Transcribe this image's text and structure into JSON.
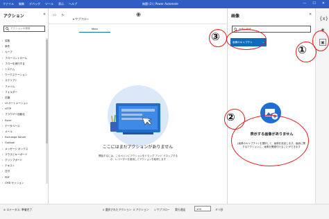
{
  "titlebar": {
    "menu": [
      "ファイル",
      "編集",
      "デバッグ",
      "ツール",
      "表示",
      "ヘルプ"
    ],
    "title": "無題 (2) | Power Automate",
    "win_min": "—",
    "win_max": "☐",
    "win_close": "✕"
  },
  "actions_pane": {
    "title": "アクション",
    "close": "✕",
    "search_placeholder": "アクションの検索",
    "items": [
      "変数",
      "条件",
      "ループ",
      "フローコントロール",
      "フローを実行する",
      "システム",
      "ワークステーション",
      "スクリプト",
      "ファイル",
      "フォルダー",
      "圧縮",
      "UI オートメーション",
      "HTTP",
      "ブラウザー自動化",
      "Excel",
      "データベース",
      "メール",
      "Exchange Server",
      "Outlook",
      "メッセージ ボックス",
      "マウスとキーボード",
      "クリップボード",
      "テキスト",
      "日付",
      "PDF",
      "CMD セッション"
    ]
  },
  "editor": {
    "subflow_label": "サブフロー",
    "tab_main": "Main",
    "empty_title": "ここにはまだアクションがありません",
    "empty_desc": "開始するには、このペインにアクションをドラッグ アンド ドロップするか、レコーダーを使用してアクションを取得します"
  },
  "images_pane": {
    "title": "画像",
    "close": "✕",
    "search_placeholder": "画像の検索",
    "capture_button": "画像のキャプチャ",
    "empty_title": "表示する画像がありません",
    "empty_desc": "(画像のキャプチャ) を選択して、画像を追加します。画面に関するアクションに、画像を関連付けることができます"
  },
  "statusbar": {
    "status": "ステータス: 準備完了",
    "selected_actions": "0 選択されたアクション",
    "actions_count": "0 アクション",
    "subflows": "1 サブフロー",
    "run_delay_label": "実行遅延",
    "run_delay_value": "100",
    "unit": "ミリ秒"
  },
  "annotations": {
    "n1": "①",
    "n2": "②",
    "n3": "③"
  },
  "colors": {
    "accent": "#0f6cbd",
    "titlebar": "#2f5dc4",
    "annotation": "#e31b1b"
  }
}
